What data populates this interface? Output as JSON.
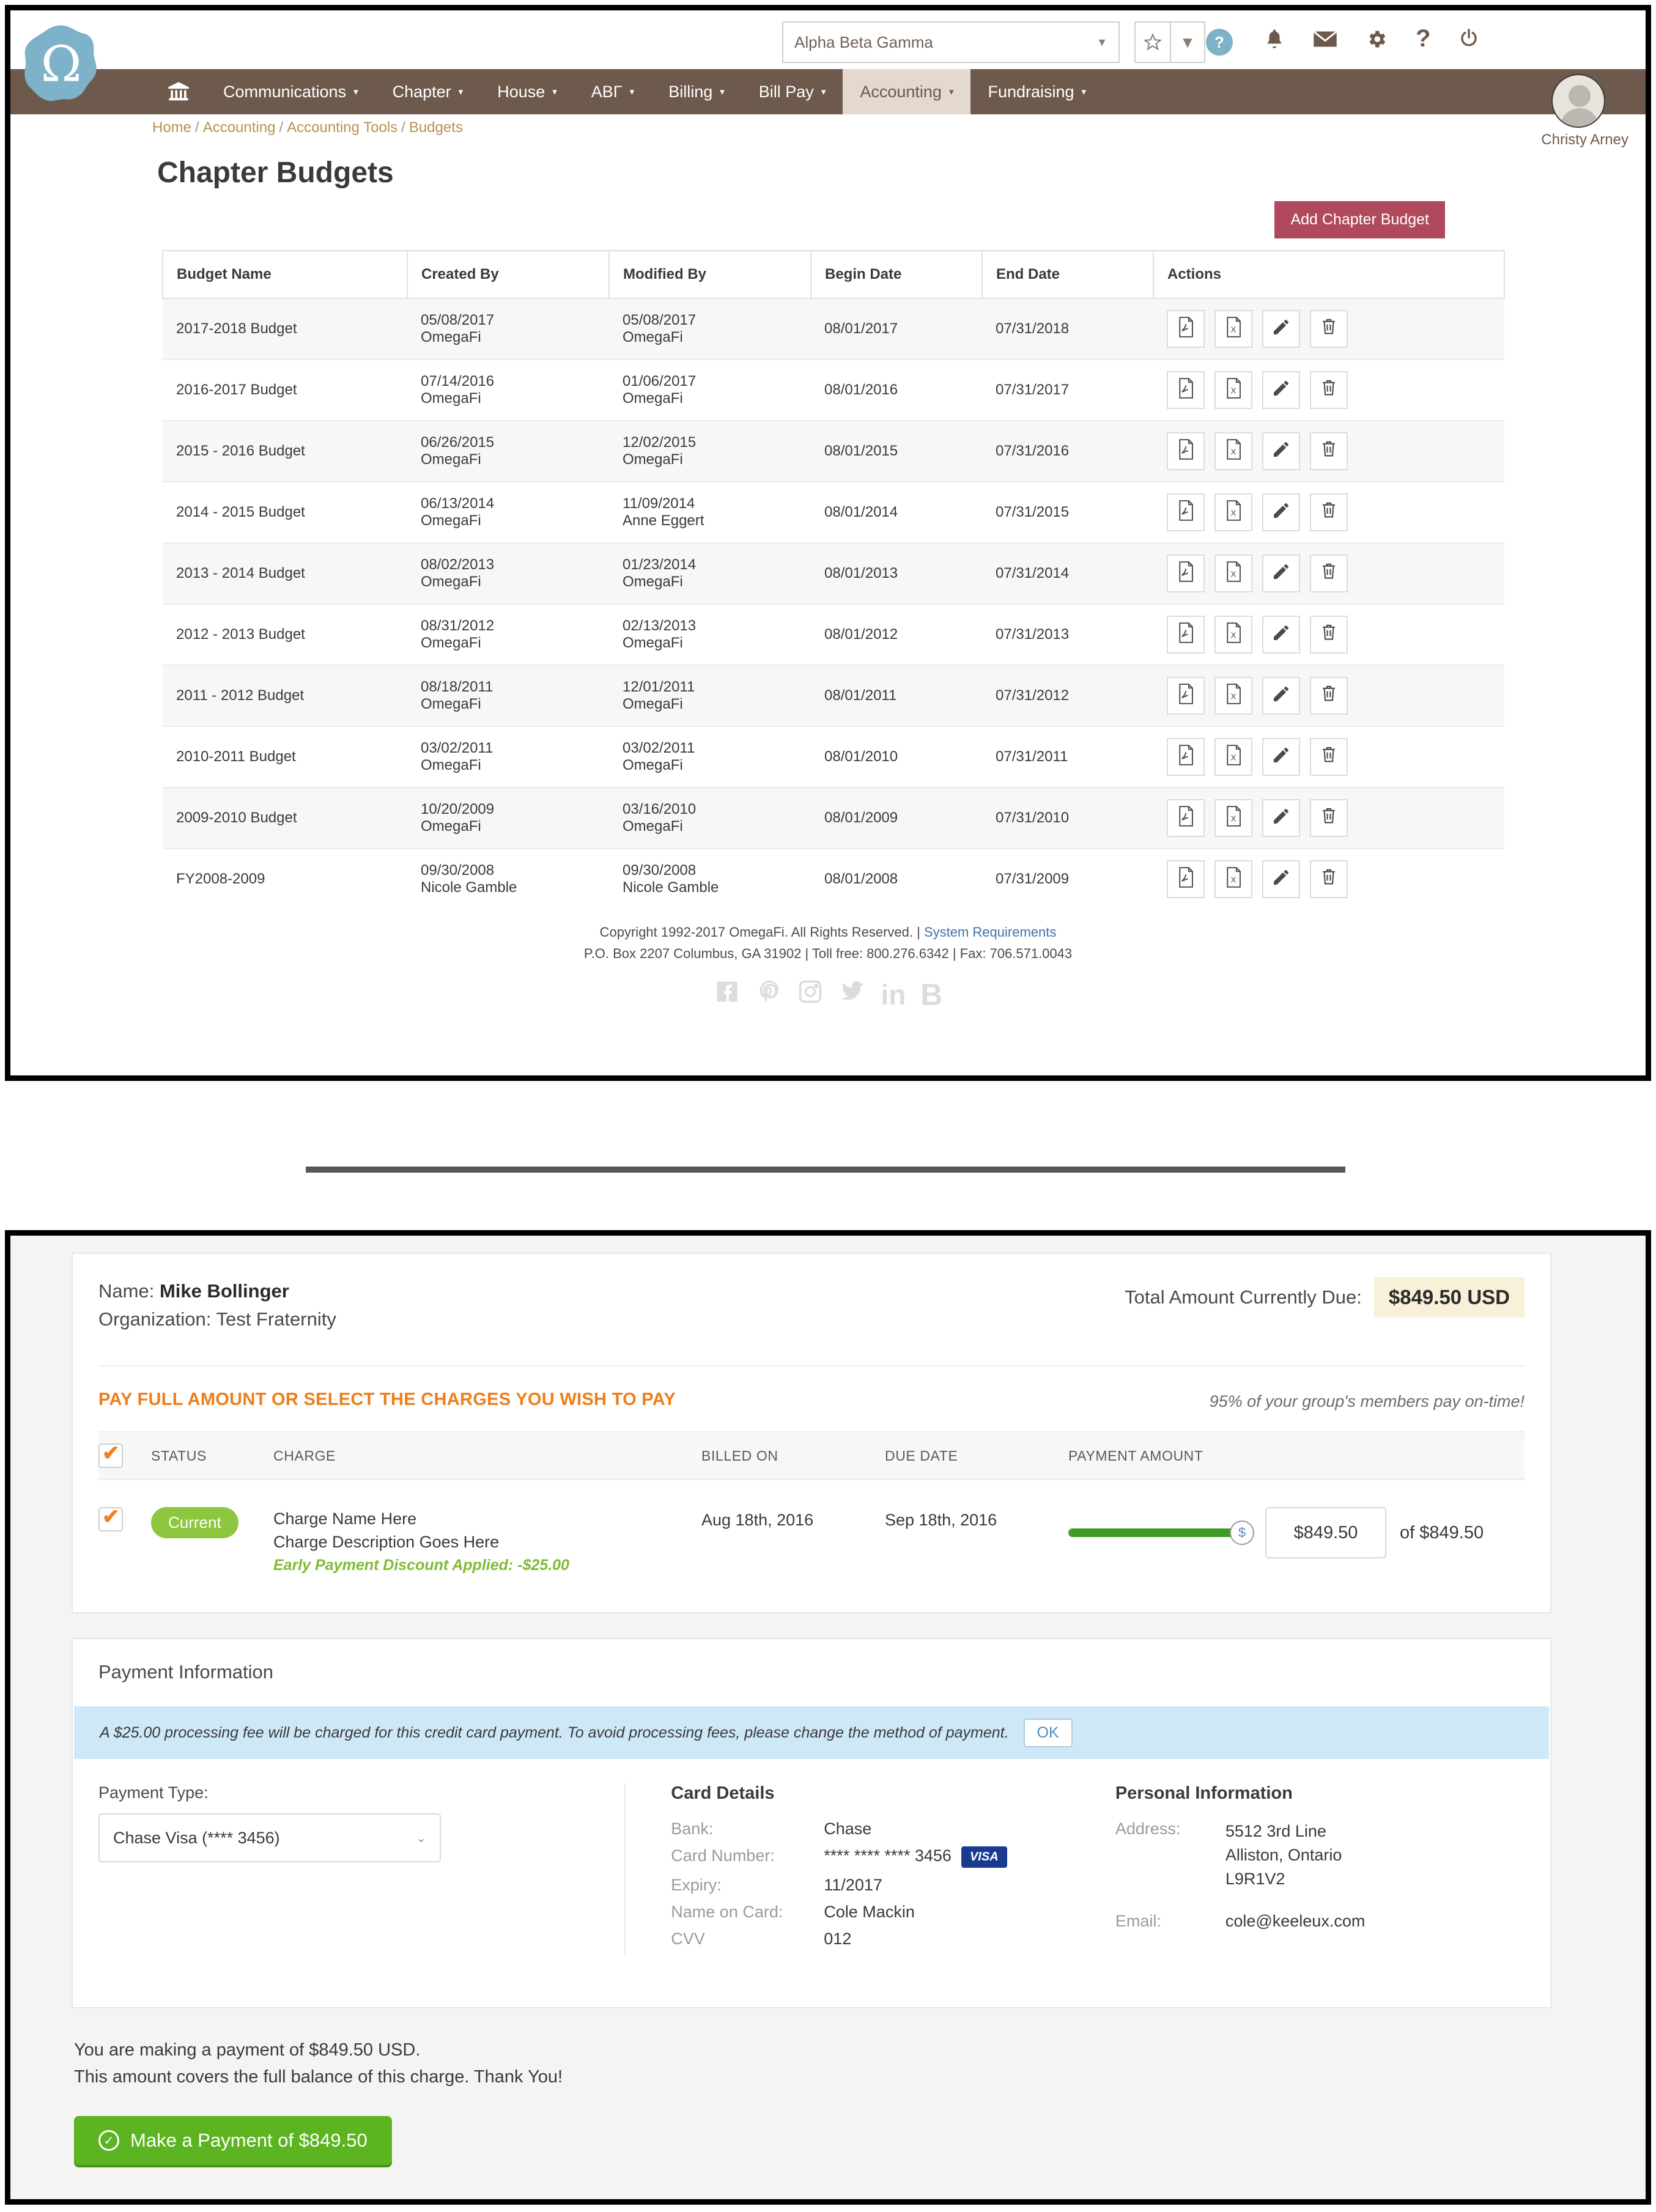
{
  "panel1": {
    "topbar": {
      "org_select_value": "Alpha Beta Gamma",
      "caret": "▼",
      "favorite_icon": "star-icon",
      "favorite_caret": "▼",
      "help_badge": "?",
      "icons": [
        "bell-icon",
        "envelope-icon",
        "gear-icon",
        "question-icon",
        "power-icon"
      ]
    },
    "nav": {
      "home_icon": "bank-home-icon",
      "items": [
        {
          "label": "Communications",
          "caret": "▾",
          "active": false
        },
        {
          "label": "Chapter",
          "caret": "▾",
          "active": false
        },
        {
          "label": "House",
          "caret": "▾",
          "active": false
        },
        {
          "label": "ΑΒΓ",
          "caret": "▾",
          "active": false
        },
        {
          "label": "Billing",
          "caret": "▾",
          "active": false
        },
        {
          "label": "Bill Pay",
          "caret": "▾",
          "active": false
        },
        {
          "label": "Accounting",
          "caret": "▾",
          "active": true
        },
        {
          "label": "Fundraising",
          "caret": "▾",
          "active": false
        }
      ]
    },
    "user": {
      "name": "Christy Arney"
    },
    "breadcrumb": [
      "Home",
      "Accounting",
      "Accounting Tools",
      "Budgets"
    ],
    "page_title": "Chapter Budgets",
    "add_button": "Add Chapter Budget",
    "table": {
      "headers": [
        "Budget Name",
        "Created By",
        "Modified By",
        "Begin Date",
        "End Date",
        "Actions"
      ],
      "action_icons": [
        "pdf-icon",
        "excel-icon",
        "pencil-icon",
        "trash-icon"
      ],
      "rows": [
        {
          "name": "2017-2018 Budget",
          "created_date": "05/08/2017",
          "created_by": "OmegaFi",
          "modified_date": "05/08/2017",
          "modified_by": "OmegaFi",
          "begin": "08/01/2017",
          "end": "07/31/2018"
        },
        {
          "name": "2016-2017 Budget",
          "created_date": "07/14/2016",
          "created_by": "OmegaFi",
          "modified_date": "01/06/2017",
          "modified_by": "OmegaFi",
          "begin": "08/01/2016",
          "end": "07/31/2017"
        },
        {
          "name": "2015 - 2016 Budget",
          "created_date": "06/26/2015",
          "created_by": "OmegaFi",
          "modified_date": "12/02/2015",
          "modified_by": "OmegaFi",
          "begin": "08/01/2015",
          "end": "07/31/2016"
        },
        {
          "name": "2014 - 2015 Budget",
          "created_date": "06/13/2014",
          "created_by": "OmegaFi",
          "modified_date": "11/09/2014",
          "modified_by": "Anne Eggert",
          "begin": "08/01/2014",
          "end": "07/31/2015"
        },
        {
          "name": "2013 - 2014 Budget",
          "created_date": "08/02/2013",
          "created_by": "OmegaFi",
          "modified_date": "01/23/2014",
          "modified_by": "OmegaFi",
          "begin": "08/01/2013",
          "end": "07/31/2014"
        },
        {
          "name": "2012 - 2013 Budget",
          "created_date": "08/31/2012",
          "created_by": "OmegaFi",
          "modified_date": "02/13/2013",
          "modified_by": "OmegaFi",
          "begin": "08/01/2012",
          "end": "07/31/2013"
        },
        {
          "name": "2011 - 2012 Budget",
          "created_date": "08/18/2011",
          "created_by": "OmegaFi",
          "modified_date": "12/01/2011",
          "modified_by": "OmegaFi",
          "begin": "08/01/2011",
          "end": "07/31/2012"
        },
        {
          "name": "2010-2011 Budget",
          "created_date": "03/02/2011",
          "created_by": "OmegaFi",
          "modified_date": "03/02/2011",
          "modified_by": "OmegaFi",
          "begin": "08/01/2010",
          "end": "07/31/2011"
        },
        {
          "name": "2009-2010 Budget",
          "created_date": "10/20/2009",
          "created_by": "OmegaFi",
          "modified_date": "03/16/2010",
          "modified_by": "OmegaFi",
          "begin": "08/01/2009",
          "end": "07/31/2010"
        },
        {
          "name": "FY2008-2009",
          "created_date": "09/30/2008",
          "created_by": "Nicole Gamble",
          "modified_date": "09/30/2008",
          "modified_by": "Nicole Gamble",
          "begin": "08/01/2008",
          "end": "07/31/2009"
        }
      ]
    },
    "footer": {
      "line1_pre": "Copyright 1992-2017 OmegaFi. All Rights Reserved. | ",
      "line1_link": "System Requirements",
      "line2": "P.O. Box 2207 Columbus, GA 31902 | Toll free: 800.276.6342 | Fax: 706.571.0043",
      "social": [
        "facebook-icon",
        "pinterest-icon",
        "instagram-icon",
        "twitter-icon",
        "linkedin-icon",
        "blogger-icon"
      ]
    }
  },
  "panel2": {
    "customer": {
      "name_label": "Name:",
      "name_value": "Mike Bollinger",
      "org_label": "Organization:",
      "org_value": "Test Fraternity"
    },
    "due": {
      "label": "Total Amount Currently Due:",
      "amount": "$849.50 USD"
    },
    "headline": "PAY FULL AMOUNT OR SELECT THE CHARGES YOU WISH TO PAY",
    "subnote": "95% of your group's members pay on-time!",
    "charges_table": {
      "headers": [
        "STATUS",
        "CHARGE",
        "BILLED ON",
        "DUE DATE",
        "PAYMENT AMOUNT"
      ],
      "row": {
        "status": "Current",
        "charge_name": "Charge Name Here",
        "charge_description": "Charge Description Goes Here",
        "discount_note": "Early Payment Discount Applied: -$25.00",
        "billed_on": "Aug 18th, 2016",
        "due_date": "Sep 18th, 2016",
        "amount_value": "$849.50",
        "amount_of": "of $849.50",
        "slider_percent": 100,
        "knob_glyph": "$"
      }
    },
    "payment_information": {
      "title": "Payment Information",
      "banner_text": "A $25.00 processing fee will be charged for this credit card payment. To avoid processing fees, please change the method of payment.",
      "banner_ok": "OK",
      "payment_type_label": "Payment Type:",
      "payment_type_value": "Chase Visa (**** 3456)",
      "payment_type_caret": "⌄",
      "card_details_title": "Card Details",
      "card_details": [
        {
          "key": "Bank:",
          "value": "Chase"
        },
        {
          "key": "Card Number:",
          "value": "**** **** **** 3456"
        },
        {
          "key": "Expiry:",
          "value": "11/2017"
        },
        {
          "key": "Name on Card:",
          "value": "Cole Mackin"
        },
        {
          "key": "CVV",
          "value": "012"
        }
      ],
      "card_brand": "VISA",
      "personal_title": "Personal Information",
      "address_label": "Address:",
      "address_lines": [
        "5512 3rd Line",
        "Alliston, Ontario",
        "L9R1V2"
      ],
      "email_label": "Email:",
      "email_value": "cole@keeleux.com"
    },
    "summary_line1": "You are making a payment of $849.50 USD.",
    "summary_line2": "This amount covers the full balance of this charge. Thank You!",
    "pay_button": "Make a Payment of $849.50"
  },
  "colors": {
    "nav_brown": "#6d5a4c",
    "nav_active": "#e3d9cf",
    "brand_blue": "#7eb2c8",
    "accent_red": "#b0495b",
    "accent_orange": "#ef7d1a",
    "green": "#5cb420",
    "badge_green": "#8dc63f",
    "due_highlight": "#f8f0d8",
    "banner_blue": "#cfe8f7",
    "link_blue": "#3f72a8",
    "breadcrumb_gold": "#b9914e"
  }
}
